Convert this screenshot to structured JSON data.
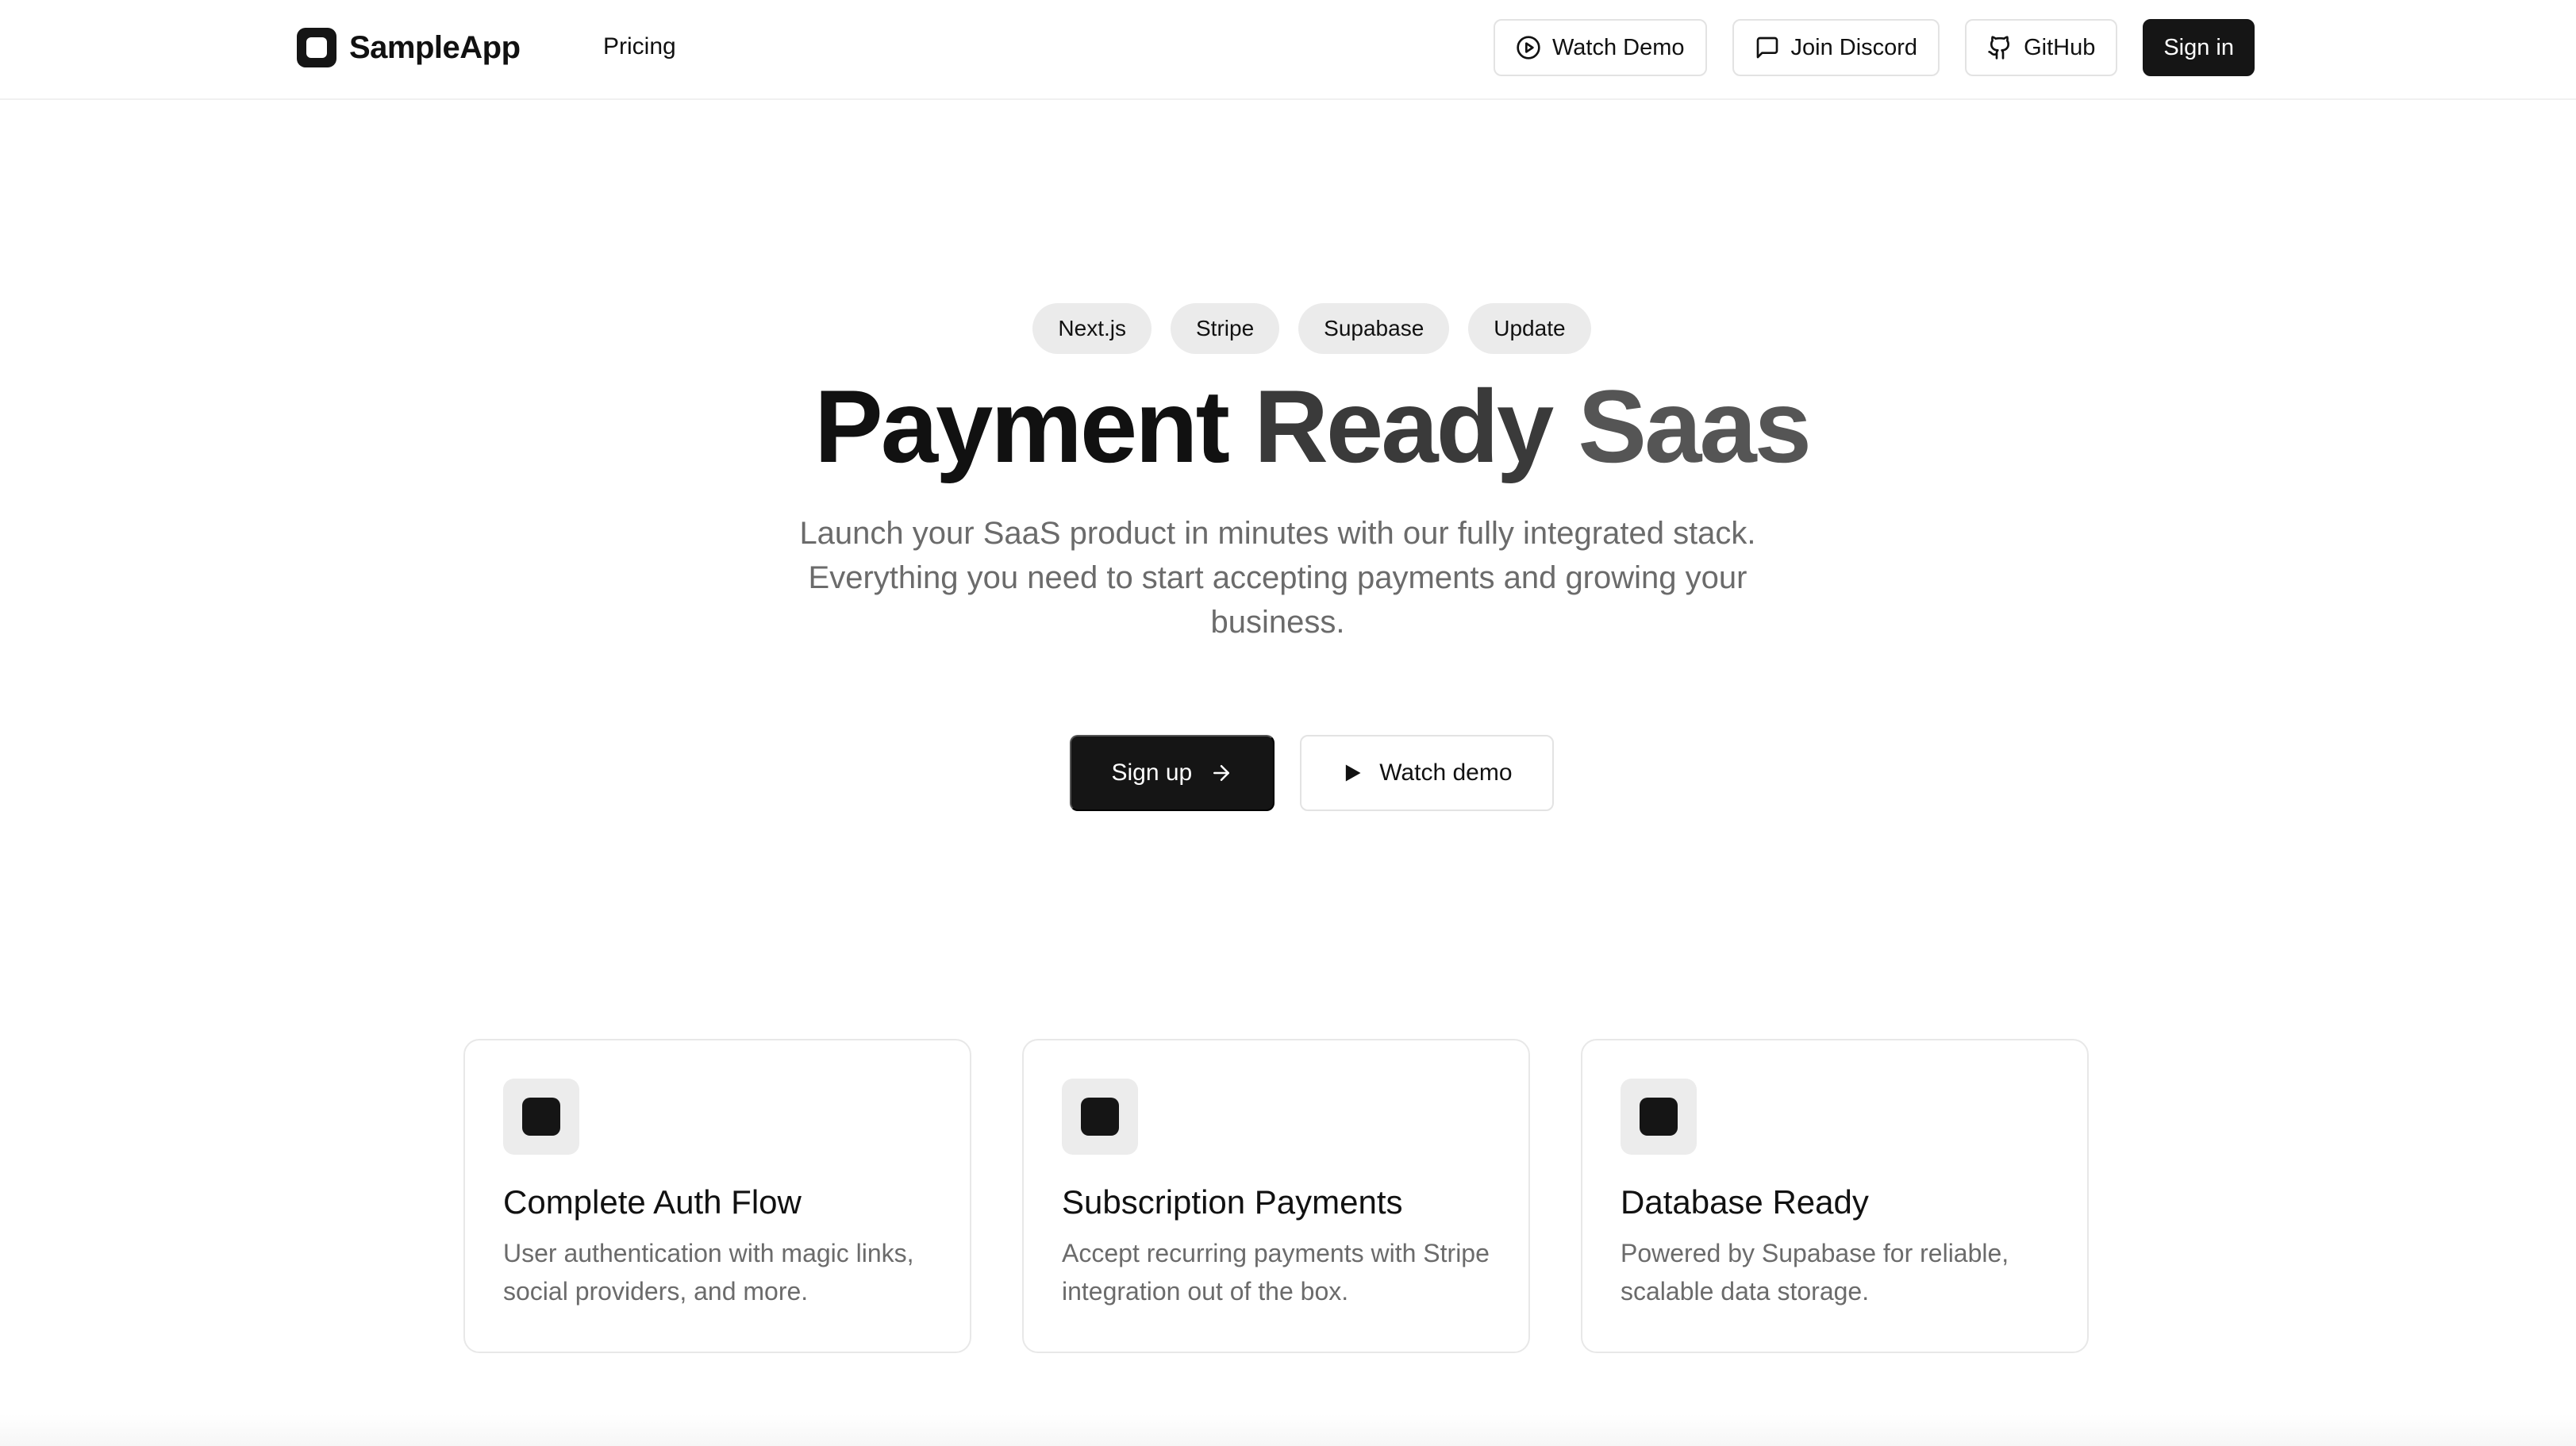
{
  "nav": {
    "brand": "SampleApp",
    "links": [
      "Pricing"
    ],
    "watch_demo": "Watch Demo",
    "join_discord": "Join Discord",
    "github": "GitHub",
    "sign_in": "Sign in"
  },
  "hero": {
    "badges": [
      "Next.js",
      "Stripe",
      "Supabase",
      "Update"
    ],
    "title_part1": "Payment",
    "title_part2": "Ready",
    "title_part3": "Saas",
    "subtitle": "Launch your SaaS product in minutes with our fully integrated stack. Everything you need to start accepting payments and growing your business.",
    "primary_cta": "Sign up",
    "secondary_cta": "Watch demo"
  },
  "features": [
    {
      "title": "Complete Auth Flow",
      "description": "User authentication with magic links, social providers, and more."
    },
    {
      "title": "Subscription Payments",
      "description": "Accept recurring payments with Stripe integration out of the box."
    },
    {
      "title": "Database Ready",
      "description": "Powered by Supabase for reliable, scalable data storage."
    }
  ],
  "icons": {
    "brand": "app-logo-icon",
    "watch_demo": "play-circle-icon",
    "join_discord": "message-square-icon",
    "github": "github-icon",
    "sign_up": "arrow-right-icon",
    "watch_demo_hero": "play-icon",
    "feature": "square-icon"
  },
  "colors": {
    "primary": "#151515",
    "background": "#ffffff",
    "muted_text": "#6b6b6b",
    "badge_bg": "#ebebeb",
    "border": "#e3e3e3"
  }
}
